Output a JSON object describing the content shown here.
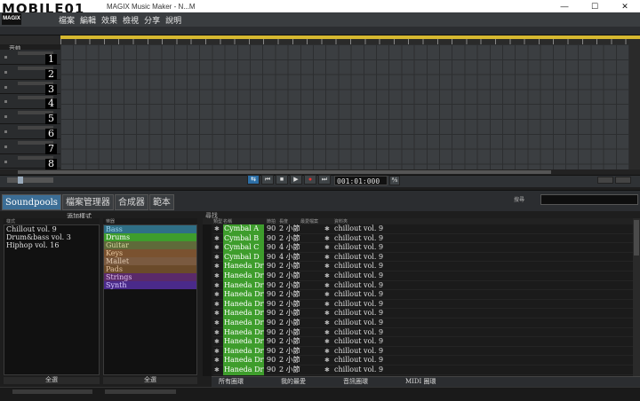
{
  "window": {
    "title": "MAGIX Music Maker - N...M",
    "logo": "MOBILE01",
    "brand": "MAGIX",
    "controls": [
      "—",
      "☐",
      "✕"
    ]
  },
  "menu": [
    "檔案",
    "編輯",
    "效果",
    "檢視",
    "分享",
    "說明"
  ],
  "arranger": {
    "header_label": "音軌",
    "tracks": [
      "1",
      "2",
      "3",
      "4",
      "5",
      "6",
      "7",
      "8"
    ]
  },
  "transport": {
    "buttons": [
      {
        "name": "loop",
        "symbol": "⇆",
        "active": true
      },
      {
        "name": "rewind",
        "symbol": "⏮",
        "active": false
      },
      {
        "name": "stop",
        "symbol": "■",
        "active": false
      },
      {
        "name": "play",
        "symbol": "▶",
        "active": false
      },
      {
        "name": "record",
        "symbol": "●",
        "active": false
      },
      {
        "name": "forward",
        "symbol": "⏭",
        "active": false
      }
    ],
    "timecode": "001:01:000",
    "extra": "⅍"
  },
  "media_pool": {
    "tabs": [
      "Soundpools",
      "檔案管理器",
      "合成器",
      "範本"
    ],
    "active_tab": 0,
    "search_label": "搜尋",
    "search_placeholder": "",
    "add_style_label": "添加樣式",
    "style_header": "樣式",
    "styles": [
      "Chillout vol. 9",
      "Drum&bass vol. 3",
      "Hiphop vol. 16"
    ],
    "style_footer": "全選",
    "instrument_header": "樂器",
    "instruments": [
      {
        "label": "Bass",
        "color": "#2f6f86",
        "text": "#9fd4f0"
      },
      {
        "label": "Drums",
        "color": "#3e9d2c",
        "text": "#ffffff"
      },
      {
        "label": "Guitar",
        "color": "#5f6a3a",
        "text": "#d8d8a0"
      },
      {
        "label": "Keys",
        "color": "#7a5230",
        "text": "#e8c8a0"
      },
      {
        "label": "Mallet",
        "color": "#7a5a40",
        "text": "#e0c8b0"
      },
      {
        "label": "Pads",
        "color": "#6a4a2a",
        "text": "#e0c0a0"
      },
      {
        "label": "Strings",
        "color": "#5a2a6a",
        "text": "#e0c0f0"
      },
      {
        "label": "Synth",
        "color": "#4a2a8a",
        "text": "#d8c8ff"
      }
    ],
    "instrument_footer": "全選",
    "found_label": "尋找",
    "file_columns": [
      "類型",
      "名稱",
      "節拍",
      "長度",
      "最愛檔案",
      "資料夾"
    ],
    "files": [
      {
        "name": "Cymbal A",
        "bpm": "90",
        "len": "2 小節",
        "folder": "chillout vol. 9"
      },
      {
        "name": "Cymbal B",
        "bpm": "90",
        "len": "2 小節",
        "folder": "chillout vol. 9"
      },
      {
        "name": "Cymbal C",
        "bpm": "90",
        "len": "4 小節",
        "folder": "chillout vol. 9"
      },
      {
        "name": "Cymbal D",
        "bpm": "90",
        "len": "4 小節",
        "folder": "chillout vol. 9"
      },
      {
        "name": "Haneda Drum",
        "bpm": "90",
        "len": "2 小節",
        "folder": "chillout vol. 9"
      },
      {
        "name": "Haneda Drum",
        "bpm": "90",
        "len": "2 小節",
        "folder": "chillout vol. 9"
      },
      {
        "name": "Haneda Drum",
        "bpm": "90",
        "len": "2 小節",
        "folder": "chillout vol. 9"
      },
      {
        "name": "Haneda Drum",
        "bpm": "90",
        "len": "2 小節",
        "folder": "chillout vol. 9"
      },
      {
        "name": "Haneda Drum",
        "bpm": "90",
        "len": "2 小節",
        "folder": "chillout vol. 9"
      },
      {
        "name": "Haneda Drum",
        "bpm": "90",
        "len": "2 小節",
        "folder": "chillout vol. 9"
      },
      {
        "name": "Haneda Drum",
        "bpm": "90",
        "len": "2 小節",
        "folder": "chillout vol. 9"
      },
      {
        "name": "Haneda Drum",
        "bpm": "90",
        "len": "2 小節",
        "folder": "chillout vol. 9"
      },
      {
        "name": "Haneda Drum",
        "bpm": "90",
        "len": "2 小節",
        "folder": "chillout vol. 9"
      },
      {
        "name": "Haneda Drum",
        "bpm": "90",
        "len": "2 小節",
        "folder": "chillout vol. 9"
      },
      {
        "name": "Haneda Drum",
        "bpm": "90",
        "len": "2 小節",
        "folder": "chillout vol. 9"
      },
      {
        "name": "Haneda Drum",
        "bpm": "90",
        "len": "2 小節",
        "folder": "chillout vol. 9"
      }
    ],
    "footer_tabs": [
      "所有圈環",
      "我的最愛",
      "音訊圈環",
      "MIDI 圈環"
    ]
  }
}
